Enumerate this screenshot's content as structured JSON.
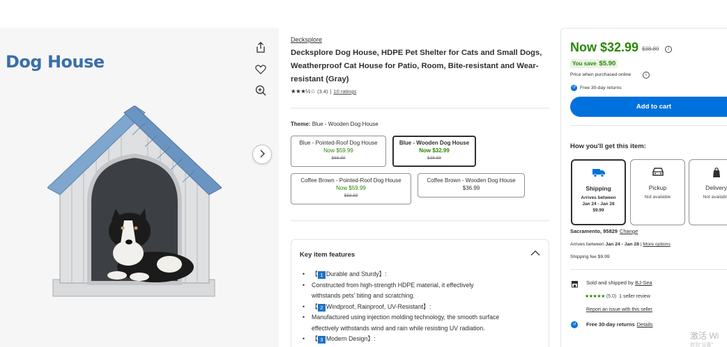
{
  "gallery": {
    "overlay_title": "Dog House",
    "icons": [
      "share-icon",
      "heart-icon",
      "zoom-icon",
      "chevron-right-icon"
    ]
  },
  "product": {
    "brand": "Decksplore",
    "title": "Decksplore Dog House, HDPE Pet Shelter for Cats and Small Dogs, Weatherproof Cat House for Patio, Room, Bite-resistant and Wear-resistant (Gray)",
    "stars": "★★★½☆",
    "rating_value": "(3.4)",
    "separator": "|",
    "ratings_link": "10 ratings"
  },
  "theme": {
    "label": "Theme:",
    "selected_value": "Blue - Wooden Dog House",
    "options": [
      {
        "name": "Blue - Pointed-Roof Dog House",
        "now": "Now $59.99",
        "was": "$68.89"
      },
      {
        "name": "Blue - Wooden Dog House",
        "now": "Now $32.99",
        "was": "$38.89"
      },
      {
        "name": "Coffee Brown - Pointed-Roof Dog House",
        "now": "Now $59.99",
        "was": "$68.89"
      },
      {
        "name": "Coffee Brown - Wooden Dog House",
        "price": "$36.99"
      }
    ]
  },
  "key_features": {
    "title": "Key item features",
    "items": [
      {
        "prefix": "【",
        "num": "1",
        "text": "Durable and Sturdy】:"
      },
      {
        "text": "Constructed from high-strength HDPE material, it effectively"
      },
      {
        "text": "withstands pets' biting and scratching."
      },
      {
        "prefix": "【",
        "num": "2",
        "text": "Windproof, Rainproof, UV-Resistant】:"
      },
      {
        "text": "Manufactured using injection molding technology, the smooth surface"
      },
      {
        "text": "effectively withstands wind and rain while resisting UV radiation."
      },
      {
        "prefix": "【",
        "num": "3",
        "text": "Modern Design】:"
      }
    ]
  },
  "buybox": {
    "price_now": "Now $32.99",
    "price_was": "$38.89",
    "you_save_label": "You save",
    "you_save_amount": "$5.90",
    "price_note": "Price when purchased online",
    "free_returns": "Free 30-day returns",
    "add_to_cart": "Add to cart",
    "how_title": "How you'll get this item:",
    "fulfillment": [
      {
        "name": "Shipping",
        "line1": "Arrives between",
        "line2": "Jan 24 - Jan 28",
        "line3": "$9.99",
        "icon": "truck-icon"
      },
      {
        "name": "Pickup",
        "line1": "Not available",
        "icon": "car-icon"
      },
      {
        "name": "Delivery",
        "line1": "Not available",
        "icon": "bag-icon"
      }
    ],
    "location": "Sacramento, 95829",
    "change_link": "Change",
    "arrives_prefix": "Arrives between",
    "arrives_dates": "Jan 24 - Jan 28",
    "more_options": "More options",
    "shipping_fee": "Shipping fee $9.99",
    "sold_by_label": "Sold and shipped by",
    "seller": "BJ-Sea",
    "seller_stars": "★★★★★",
    "seller_rating": "(5.0)",
    "seller_reviews": "1 seller review",
    "report_issue": "Report an issue with this seller",
    "free_returns_bold": "Free 30-day returns",
    "details_link": "Details"
  },
  "watermark": {
    "line1": "激活 Wi",
    "line2": "转到\"设置\""
  },
  "colors": {
    "accent_blue": "#0071dc",
    "price_green": "#2a8703",
    "title_blue": "#3a6fa8"
  }
}
